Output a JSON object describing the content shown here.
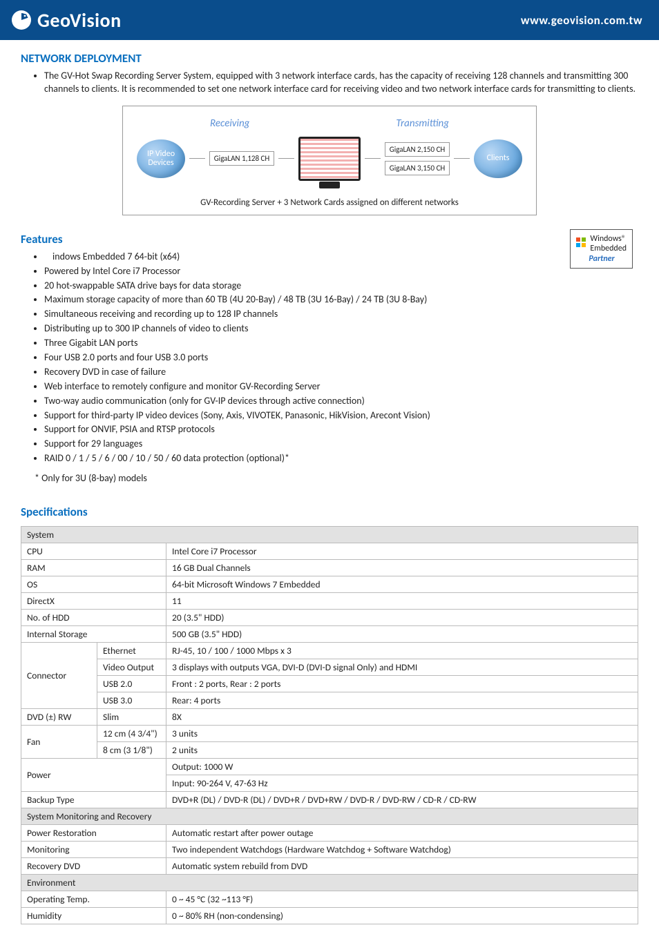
{
  "header": {
    "brand": "GeoVision",
    "url": "www.geovision.com.tw"
  },
  "section1": {
    "title": "NETWORK DEPLOYMENT",
    "bullets": [
      "The GV-Hot Swap Recording Server System, equipped with 3 network interface cards, has the capacity of receiving 128 channels and transmitting 300 channels to clients. It is recommended to set one network interface card for receiving video and two network interface cards for transmitting to clients."
    ]
  },
  "diagram": {
    "receiving": "Receiving",
    "transmitting": "Transmitting",
    "ipdevices": "IP Video Devices",
    "clients": "Clients",
    "lan1": "GigaLAN 1,128 CH",
    "lan2": "GigaLAN 2,150 CH",
    "lan3": "GigaLAN 3,150 CH",
    "caption": "GV-Recording Server + 3 Network Cards assigned on different networks"
  },
  "features": {
    "title": "Features",
    "items": [
      "indows Embedded 7 64-bit (x64)",
      "Powered by Intel Core i7 Processor",
      "20 hot-swappable SATA drive bays for data storage",
      "Maximum storage capacity of more than 60 TB (4U 20-Bay) / 48 TB (3U 16-Bay) / 24 TB (3U 8-Bay)",
      "Simultaneous receiving and recording up to 128 IP channels",
      "Distributing up to 300 IP channels of video to clients",
      "Three Gigabit LAN ports",
      "Four USB 2.0 ports and four USB 3.0 ports",
      "Recovery DVD in case of failure",
      "Web interface to remotely configure and monitor GV-Recording Server",
      "Two-way audio communication (only for GV-IP devices through active connection)",
      "Support for third-party IP video devices (Sony, Axis, VIVOTEK, Panasonic, HikVision, Arecont Vision)",
      "Support for ONVIF, PSIA and RTSP protocols",
      "Support for 29 languages",
      "RAID 0 / 1 / 5 / 6 / 00 / 10 / 50 / 60 data protection (optional)*"
    ],
    "note": "* Only for 3U (8-bay) models",
    "badge_line1": "Windows®",
    "badge_line2": "Embedded",
    "badge_partner": "Partner"
  },
  "specs": {
    "title": "Specifications",
    "system_hdr": "System",
    "rows": {
      "cpu_l": "CPU",
      "cpu_v": "Intel Core i7 Processor",
      "ram_l": "RAM",
      "ram_v": "16 GB Dual Channels",
      "os_l": "OS",
      "os_v": "64-bit Microsoft Windows 7 Embedded",
      "dx_l": "DirectX",
      "dx_v": "11",
      "hdd_l": "No. of HDD",
      "hdd_v": "20 (3.5\" HDD)",
      "istore_l": "Internal Storage",
      "istore_v": "500 GB (3.5\" HDD)",
      "conn_l": "Connector",
      "eth_l": "Ethernet",
      "eth_v": "RJ-45, 10 / 100 / 1000 Mbps x 3",
      "vout_l": "Video Output",
      "vout_v": "3 displays with outputs VGA, DVI-D (DVI-D signal Only) and HDMI",
      "usb2_l": "USB 2.0",
      "usb2_v": "Front : 2 ports, Rear : 2 ports",
      "usb3_l": "USB 3.0",
      "usb3_v": "Rear: 4 ports",
      "dvd_l": "DVD (±) RW",
      "dvd_sl": "Slim",
      "dvd_v": "8X",
      "fan_l": "Fan",
      "fan1_sl": "12 cm (4 3/4\")",
      "fan1_v": "3 units",
      "fan2_sl": "8 cm (3 1/8\")",
      "fan2_v": "2 units",
      "pwr_l": "Power",
      "pwr_v1": "Output: 1000 W",
      "pwr_v2": "Input: 90-264 V, 47-63 Hz",
      "bkp_l": "Backup Type",
      "bkp_v": "DVD+R (DL) / DVD-R (DL) / DVD+R / DVD+RW / DVD-R / DVD-RW / CD-R / CD-RW"
    },
    "smr_hdr": "System Monitoring and Recovery",
    "smr": {
      "pr_l": "Power Restoration",
      "pr_v": "Automatic restart after power outage",
      "mon_l": "Monitoring",
      "mon_v": "Two independent Watchdogs (Hardware Watchdog + Software Watchdog)",
      "rdvd_l": "Recovery DVD",
      "rdvd_v": "Automatic system rebuild from DVD"
    },
    "env_hdr": "Environment",
    "env": {
      "ot_l": "Operating Temp.",
      "ot_v": "0 ~ 45 °C (32 ~113 °F)",
      "hum_l": "Humidity",
      "hum_v": "0 ~ 80% RH (non-condensing)"
    }
  }
}
